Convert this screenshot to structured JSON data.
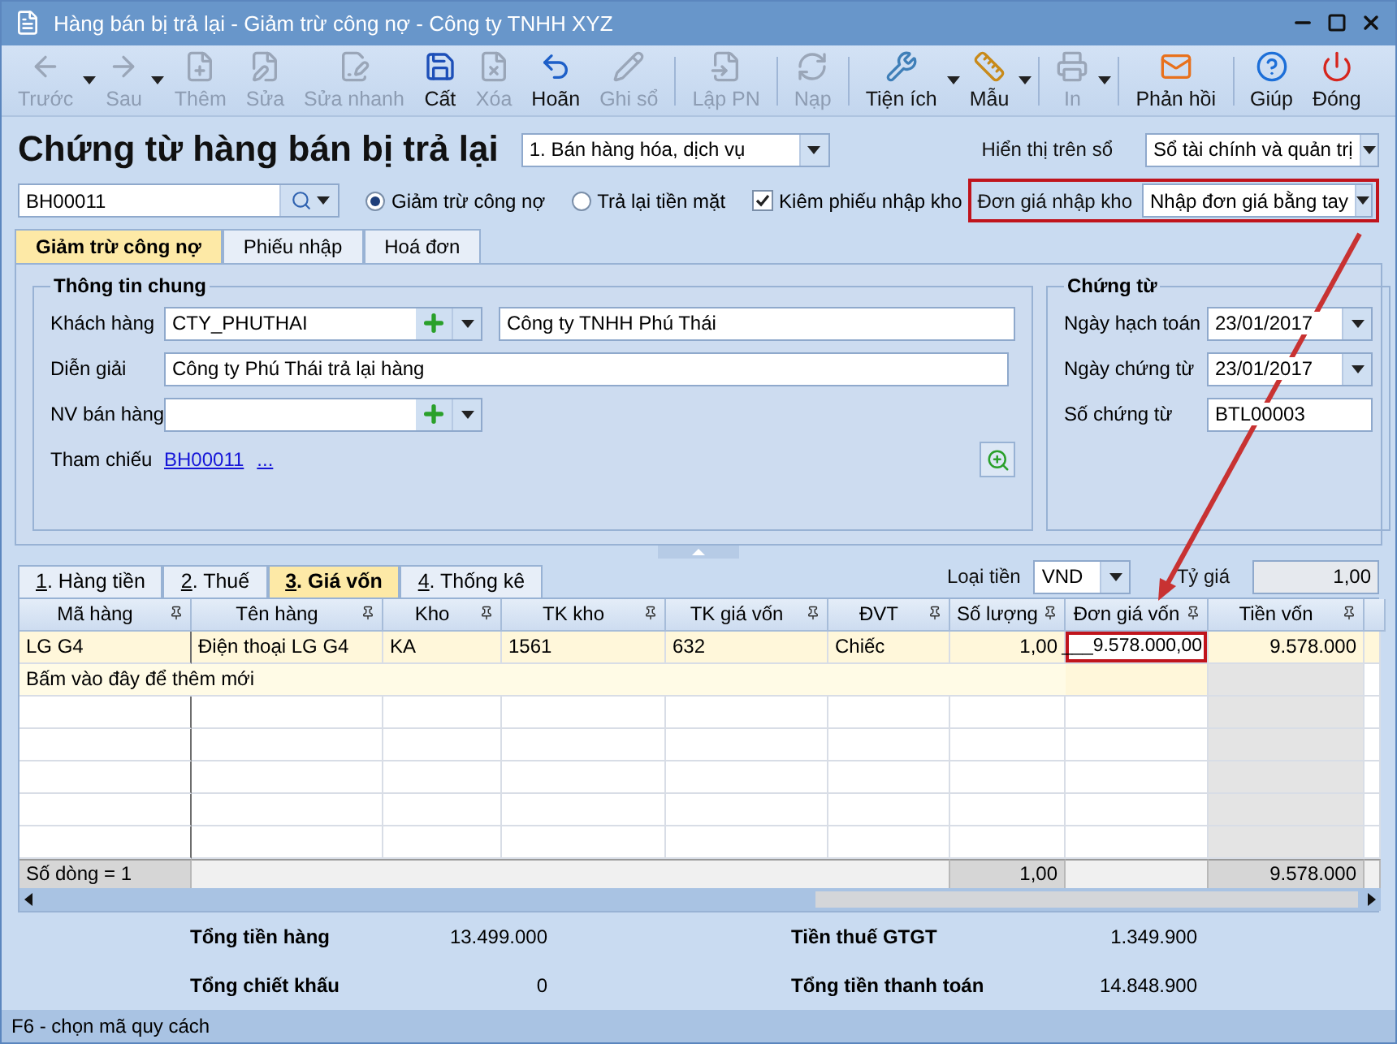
{
  "window": {
    "title": "Hàng bán bị trả lại - Giảm trừ công nợ - Công ty TNHH XYZ"
  },
  "toolbar": [
    {
      "label": "Trước",
      "disabled": true,
      "dropdown": true,
      "group_start": false
    },
    {
      "label": "Sau",
      "disabled": true,
      "dropdown": true,
      "group_start": false
    },
    {
      "label": "Thêm",
      "disabled": true,
      "dropdown": false,
      "group_start": false
    },
    {
      "label": "Sửa",
      "disabled": true,
      "dropdown": false,
      "group_start": false
    },
    {
      "label": "Sửa nhanh",
      "disabled": true,
      "dropdown": false,
      "group_start": false
    },
    {
      "label": "Cất",
      "disabled": false,
      "dropdown": false,
      "group_start": false
    },
    {
      "label": "Xóa",
      "disabled": true,
      "dropdown": false,
      "group_start": false
    },
    {
      "label": "Hoãn",
      "disabled": false,
      "dropdown": false,
      "group_start": false
    },
    {
      "label": "Ghi sổ",
      "disabled": true,
      "dropdown": false,
      "group_start": false
    },
    {
      "label": "Lập PN",
      "disabled": true,
      "dropdown": false,
      "group_start": true
    },
    {
      "label": "Nạp",
      "disabled": true,
      "dropdown": false,
      "group_start": true
    },
    {
      "label": "Tiện ích",
      "disabled": false,
      "dropdown": true,
      "group_start": true
    },
    {
      "label": "Mẫu",
      "disabled": false,
      "dropdown": true,
      "group_start": false
    },
    {
      "label": "In",
      "disabled": true,
      "dropdown": true,
      "group_start": true
    },
    {
      "label": "Phản hồi",
      "disabled": false,
      "dropdown": false,
      "group_start": true
    },
    {
      "label": "Giúp",
      "disabled": false,
      "dropdown": false,
      "group_start": true
    },
    {
      "label": "Đóng",
      "disabled": false,
      "dropdown": false,
      "group_start": false
    }
  ],
  "form_title": "Chứng từ hàng bán bị trả lại",
  "sale_type": {
    "value": "1. Bán hàng hóa, dịch vụ"
  },
  "ledger": {
    "label": "Hiển thị trên sổ",
    "value": "Sổ tài chính và quản trị"
  },
  "search": {
    "value": "BH00011"
  },
  "options": [
    {
      "kind": "radio",
      "label": "Giảm trừ công nợ",
      "selected": true
    },
    {
      "kind": "radio",
      "label": "Trả lại tiền mặt",
      "selected": false
    },
    {
      "kind": "checkbox",
      "label": "Kiêm phiếu nhập kho",
      "checked": true
    }
  ],
  "unit_price": {
    "label": "Đơn giá nhập kho",
    "value": "Nhập đơn giá bằng tay",
    "highlighted": true
  },
  "tabs": [
    {
      "label": "Giảm trừ công nợ",
      "selected": true
    },
    {
      "label": "Phiếu nhập",
      "selected": false
    },
    {
      "label": "Hoá đơn",
      "selected": false
    }
  ],
  "general_info": {
    "title": "Thông tin chung",
    "customer": {
      "label": "Khách hàng",
      "code": "CTY_PHUTHAI",
      "name": "Công ty TNHH Phú Thái"
    },
    "description": {
      "label": "Diễn giải",
      "value": "Công ty Phú Thái trả lại hàng"
    },
    "salesperson": {
      "label": "NV bán hàng"
    },
    "reference": {
      "label": "Tham chiếu",
      "links": [
        "BH00011",
        "..."
      ]
    }
  },
  "voucher": {
    "title": "Chứng từ",
    "fields": [
      {
        "kind": "date",
        "label": "Ngày hạch toán",
        "value": "23/01/2017"
      },
      {
        "kind": "date",
        "label": "Ngày chứng từ",
        "value": "23/01/2017"
      },
      {
        "kind": "text",
        "label": "Số chứng từ",
        "value": "BTL00003"
      }
    ]
  },
  "detail_tabs": [
    {
      "key": "1",
      "label": ". Hàng tiền",
      "selected": false
    },
    {
      "key": "2",
      "label": ". Thuế",
      "selected": false
    },
    {
      "key": "3",
      "label": ". Giá vốn",
      "selected": true
    },
    {
      "key": "4",
      "label": ". Thống kê",
      "selected": false
    }
  ],
  "currency": {
    "label": "Loại tiền",
    "value": "VND"
  },
  "exchange_rate": {
    "label": "Tỷ giá",
    "value": "1,00"
  },
  "grid": {
    "columns": [
      {
        "title": "Mã hàng"
      },
      {
        "title": "Tên hàng"
      },
      {
        "title": "Kho"
      },
      {
        "title": "TK kho"
      },
      {
        "title": "TK giá vốn"
      },
      {
        "title": "ĐVT"
      },
      {
        "title": "Số lượng"
      },
      {
        "title": "Đơn giá vốn"
      },
      {
        "title": "Tiền vốn"
      }
    ],
    "rows": [
      {
        "selected": true,
        "cells": [
          {
            "text": "LG G4",
            "highlighted": false
          },
          {
            "text": "Điện thoại LG G4",
            "highlighted": false
          },
          {
            "text": "KA",
            "highlighted": false
          },
          {
            "text": "1561",
            "highlighted": false
          },
          {
            "text": "632",
            "highlighted": false
          },
          {
            "text": "Chiếc",
            "highlighted": false
          },
          {
            "text": "1,00",
            "highlighted": false
          },
          {
            "text": "___9.578.000,00",
            "highlighted": true
          },
          {
            "text": "9.578.000",
            "highlighted": false
          }
        ]
      }
    ],
    "new_row": "Bấm vào đây để thêm mới",
    "footer": {
      "count": "Số dòng = 1",
      "quantity": "1,00",
      "amount": "9.578.000"
    }
  },
  "summary": [
    {
      "label": "Tổng tiền hàng",
      "value": "13.499.000"
    },
    {
      "label": "Tiền thuế GTGT",
      "value": "1.349.900"
    },
    {
      "label": "Tổng chiết khấu",
      "value": "0"
    },
    {
      "label": "Tổng tiền thanh toán",
      "value": "14.848.900"
    }
  ],
  "status_bar": "F6 - chọn mã quy cách"
}
